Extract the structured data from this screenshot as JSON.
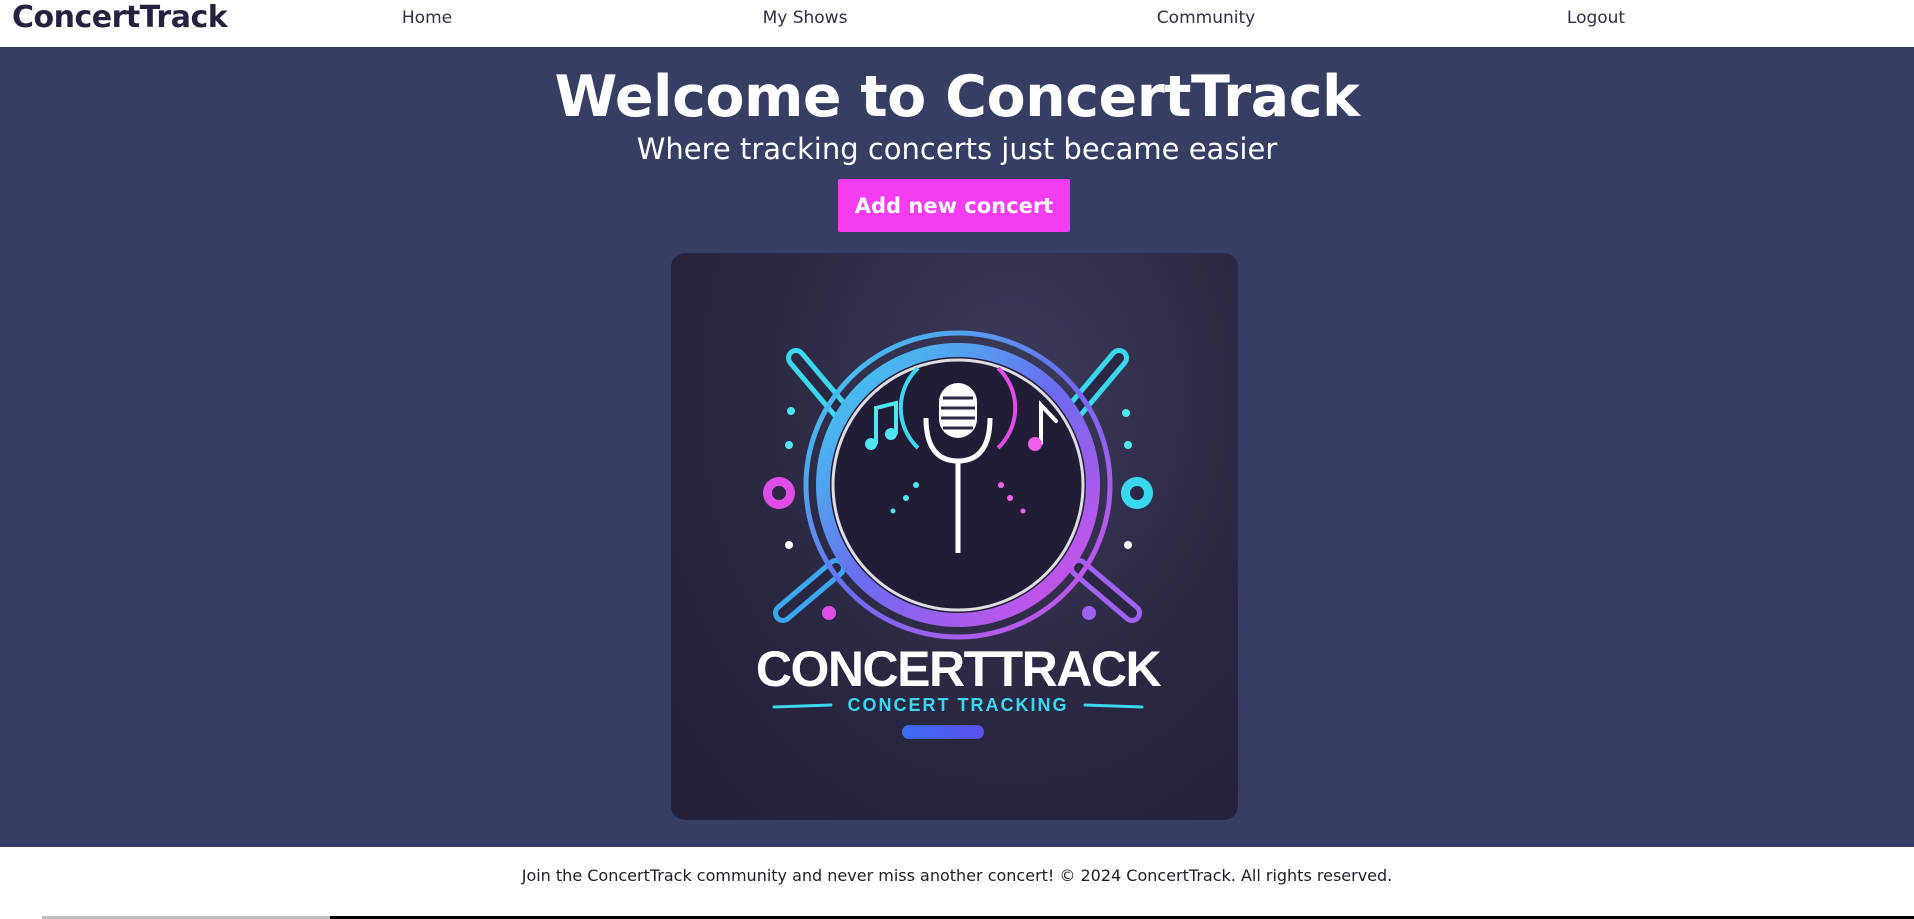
{
  "nav": {
    "brand": "ConcertTrack",
    "links": [
      "Home",
      "My Shows",
      "Community",
      "Logout"
    ]
  },
  "hero": {
    "title": "Welcome to ConcertTrack",
    "subtitle": "Where tracking concerts just became easier",
    "cta_label": "Add new concert"
  },
  "logo": {
    "wordmark": "CONCERTTRACK",
    "tagline": "CONCERT TRACKING",
    "icon": "microphone-equalizer-logo"
  },
  "footer": {
    "text": "Join the ConcertTrack community and never miss another concert! © 2024 ConcertTrack. All rights reserved."
  },
  "colors": {
    "background": "#363e63",
    "accent": "#f43cf0",
    "cyan": "#3ad8f0",
    "magenta": "#e04ce8"
  }
}
